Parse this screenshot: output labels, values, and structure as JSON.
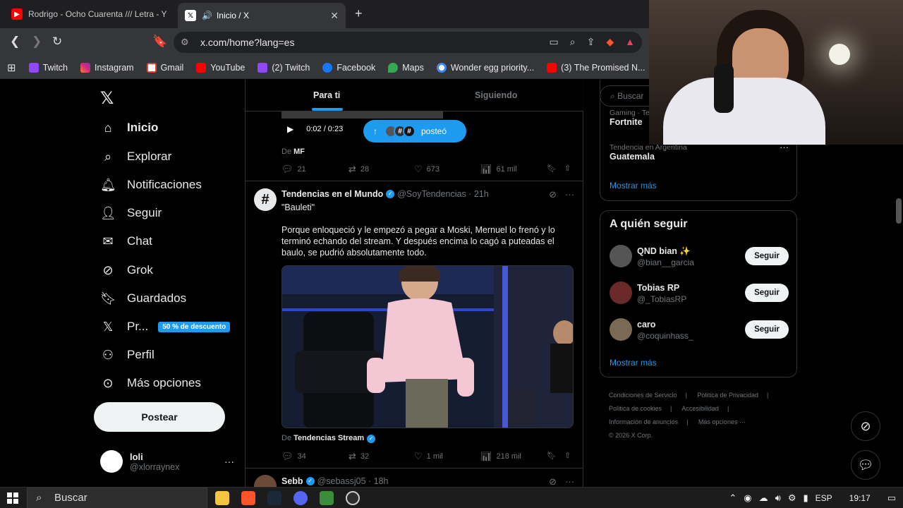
{
  "browser": {
    "tabs": [
      {
        "title": "Rodrigo - Ocho Cuarenta /// Letra - Y",
        "icon": "youtube-icon",
        "active": false
      },
      {
        "title": "Inicio / X",
        "icon": "x-icon",
        "active": true
      }
    ],
    "url": "x.com/home?lang=es",
    "bookmarks": [
      {
        "label": "Twitch",
        "icon": "twitch"
      },
      {
        "label": "Instagram",
        "icon": "insta"
      },
      {
        "label": "Gmail",
        "icon": "gmail"
      },
      {
        "label": "YouTube",
        "icon": "yt"
      },
      {
        "label": "(2) Twitch",
        "icon": "twitch"
      },
      {
        "label": "Facebook",
        "icon": "fb"
      },
      {
        "label": "Maps",
        "icon": "maps"
      },
      {
        "label": "Wonder egg priority...",
        "icon": "google"
      },
      {
        "label": "(3) The Promised N...",
        "icon": "yt"
      }
    ]
  },
  "nav": {
    "items": [
      {
        "label": "Inicio",
        "icon": "home-icon"
      },
      {
        "label": "Explorar",
        "icon": "search-icon"
      },
      {
        "label": "Notificaciones",
        "icon": "bell-icon"
      },
      {
        "label": "Seguir",
        "icon": "add-person-icon"
      },
      {
        "label": "Chat",
        "icon": "mail-icon"
      },
      {
        "label": "Grok",
        "icon": "grok-icon"
      },
      {
        "label": "Guardados",
        "icon": "bookmark-icon"
      },
      {
        "label": "Pr...",
        "icon": "x-premium-icon"
      },
      {
        "label": "Perfil",
        "icon": "person-icon"
      },
      {
        "label": "Más opciones",
        "icon": "more-circle-icon"
      }
    ],
    "promo_badge": "50 % de descuento",
    "post_button": "Postear",
    "account": {
      "name": "loli",
      "handle": "@xlorraynex"
    }
  },
  "feed": {
    "tabs": {
      "for_you": "Para ti",
      "following": "Siguiendo"
    },
    "prev_post": {
      "time": "0:02 / 0:23",
      "posted_pill": "posteó",
      "from_prefix": "De",
      "from": "MF",
      "replies": "21",
      "reposts": "28",
      "likes": "673",
      "views": "61 mil"
    },
    "post": {
      "name": "Tendencias en el Mundo",
      "handle": "@SoyTendencias",
      "time": "21h",
      "line1": "\"Bauleti\"",
      "body": "Porque enloqueció y le empezó a pegar a Moski, Mernuel lo frenó y lo terminó echando del stream. Y después encima lo cagó a puteadas el baulo, se pudrió absolutamente todo.",
      "from_prefix": "De",
      "from": "Tendencias Stream",
      "replies": "34",
      "reposts": "32",
      "likes": "1 mil",
      "views": "218 mil"
    },
    "next_post": {
      "name": "Sebb",
      "handle": "@sebassj05",
      "time": "18h"
    }
  },
  "right": {
    "search_placeholder": "Buscar",
    "trends": [
      {
        "category": "Gaming · Te",
        "name": "Fortnite"
      },
      {
        "category": "Tendencia en Argentina",
        "name": "Guatemala"
      }
    ],
    "trends_more": "Mostrar más",
    "wtf_title": "A quién seguir",
    "wtf": [
      {
        "name": "QND bian ✨",
        "handle": "@bian__garcia",
        "button": "Seguir"
      },
      {
        "name": "Tobias RP",
        "handle": "@_TobiasRP",
        "button": "Seguir"
      },
      {
        "name": "caro",
        "handle": "@coquinhass_",
        "button": "Seguir"
      }
    ],
    "wtf_more": "Mostrar más",
    "footer": {
      "terms": "Condiciones de Servicio",
      "privacy": "Política de Privacidad",
      "cookies": "Política de cookies",
      "accessibility": "Accesibilidad",
      "ads": "Información de anuncios",
      "more": "Más opciones ···",
      "copyright": "© 2026 X Corp."
    }
  },
  "taskbar": {
    "search": "Buscar",
    "lang": "ESP",
    "time": "19:17"
  }
}
